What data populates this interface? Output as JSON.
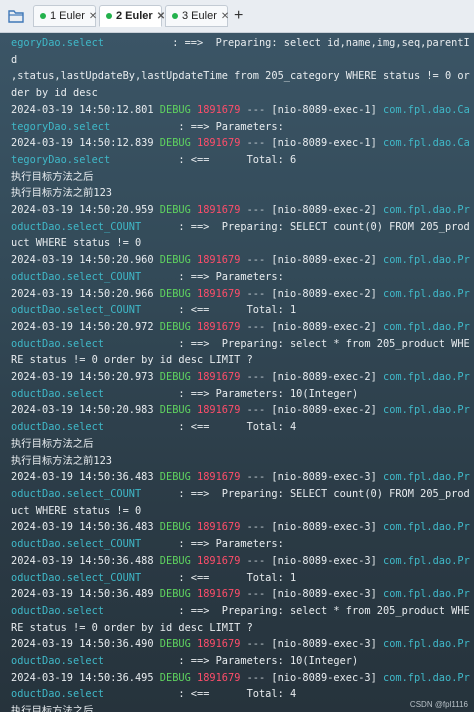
{
  "tabs": [
    {
      "label": "1 Euler",
      "status_color": "#22b14c"
    },
    {
      "label": "2 Euler",
      "status_color": "#22b14c"
    },
    {
      "label": "3 Euler",
      "status_color": "#22b14c"
    }
  ],
  "add_tab_glyph": "+",
  "close_glyph": "✕",
  "colors": {
    "debug": "#5fd35f",
    "pid": "#ff4d6a",
    "logger": "#3fb8c8",
    "text": "#e8ecef"
  },
  "log_lines": [
    {
      "parts": [
        {
          "c": "lg",
          "t": "egoryDao.select"
        },
        {
          "c": "tx",
          "t": "           : ==>  Preparing: select id,name,img,seq,parentId"
        }
      ]
    },
    {
      "parts": [
        {
          "c": "tx",
          "t": ",status,lastUpdateBy,lastUpdateTime from 205_category WHERE status != 0 order by id desc"
        }
      ]
    },
    {
      "parts": [
        {
          "c": "ts",
          "t": "2024-03-19 14:50:12.801 "
        },
        {
          "c": "lvl",
          "t": "DEBUG "
        },
        {
          "c": "pid",
          "t": "1891679"
        },
        {
          "c": "dash",
          "t": " --- "
        },
        {
          "c": "thread",
          "t": "[nio-8089-exec-1] "
        },
        {
          "c": "lg",
          "t": "com.fpl.dao.CategoryDao.select"
        },
        {
          "c": "tx",
          "t": "           : ==> Parameters: "
        }
      ]
    },
    {
      "parts": [
        {
          "c": "ts",
          "t": "2024-03-19 14:50:12.839 "
        },
        {
          "c": "lvl",
          "t": "DEBUG "
        },
        {
          "c": "pid",
          "t": "1891679"
        },
        {
          "c": "dash",
          "t": " --- "
        },
        {
          "c": "thread",
          "t": "[nio-8089-exec-1] "
        },
        {
          "c": "lg",
          "t": "com.fpl.dao.CategoryDao.select"
        },
        {
          "c": "tx",
          "t": "           : <==      Total: 6"
        }
      ]
    },
    {
      "parts": [
        {
          "c": "tx",
          "t": "执行目标方法之后"
        }
      ]
    },
    {
      "parts": [
        {
          "c": "tx",
          "t": "执行目标方法之前123"
        }
      ]
    },
    {
      "parts": [
        {
          "c": "ts",
          "t": "2024-03-19 14:50:20.959 "
        },
        {
          "c": "lvl",
          "t": "DEBUG "
        },
        {
          "c": "pid",
          "t": "1891679"
        },
        {
          "c": "dash",
          "t": " --- "
        },
        {
          "c": "thread",
          "t": "[nio-8089-exec-2] "
        },
        {
          "c": "lg",
          "t": "com.fpl.dao.ProductDao.select_COUNT"
        },
        {
          "c": "tx",
          "t": "      : ==>  Preparing: SELECT count(0) FROM 205_product WHERE status != 0"
        }
      ]
    },
    {
      "parts": [
        {
          "c": "ts",
          "t": "2024-03-19 14:50:20.960 "
        },
        {
          "c": "lvl",
          "t": "DEBUG "
        },
        {
          "c": "pid",
          "t": "1891679"
        },
        {
          "c": "dash",
          "t": " --- "
        },
        {
          "c": "thread",
          "t": "[nio-8089-exec-2] "
        },
        {
          "c": "lg",
          "t": "com.fpl.dao.ProductDao.select_COUNT"
        },
        {
          "c": "tx",
          "t": "      : ==> Parameters: "
        }
      ]
    },
    {
      "parts": [
        {
          "c": "ts",
          "t": "2024-03-19 14:50:20.966 "
        },
        {
          "c": "lvl",
          "t": "DEBUG "
        },
        {
          "c": "pid",
          "t": "1891679"
        },
        {
          "c": "dash",
          "t": " --- "
        },
        {
          "c": "thread",
          "t": "[nio-8089-exec-2] "
        },
        {
          "c": "lg",
          "t": "com.fpl.dao.ProductDao.select_COUNT"
        },
        {
          "c": "tx",
          "t": "      : <==      Total: 1"
        }
      ]
    },
    {
      "parts": [
        {
          "c": "ts",
          "t": "2024-03-19 14:50:20.972 "
        },
        {
          "c": "lvl",
          "t": "DEBUG "
        },
        {
          "c": "pid",
          "t": "1891679"
        },
        {
          "c": "dash",
          "t": " --- "
        },
        {
          "c": "thread",
          "t": "[nio-8089-exec-2] "
        },
        {
          "c": "lg",
          "t": "com.fpl.dao.ProductDao.select"
        },
        {
          "c": "tx",
          "t": "            : ==>  Preparing: select * from 205_product WHERE status != 0 order by id desc LIMIT ? "
        }
      ]
    },
    {
      "parts": [
        {
          "c": "ts",
          "t": "2024-03-19 14:50:20.973 "
        },
        {
          "c": "lvl",
          "t": "DEBUG "
        },
        {
          "c": "pid",
          "t": "1891679"
        },
        {
          "c": "dash",
          "t": " --- "
        },
        {
          "c": "thread",
          "t": "[nio-8089-exec-2] "
        },
        {
          "c": "lg",
          "t": "com.fpl.dao.ProductDao.select"
        },
        {
          "c": "tx",
          "t": "            : ==> Parameters: 10(Integer)"
        }
      ]
    },
    {
      "parts": [
        {
          "c": "ts",
          "t": "2024-03-19 14:50:20.983 "
        },
        {
          "c": "lvl",
          "t": "DEBUG "
        },
        {
          "c": "pid",
          "t": "1891679"
        },
        {
          "c": "dash",
          "t": " --- "
        },
        {
          "c": "thread",
          "t": "[nio-8089-exec-2] "
        },
        {
          "c": "lg",
          "t": "com.fpl.dao.ProductDao.select"
        },
        {
          "c": "tx",
          "t": "            : <==      Total: 4"
        }
      ]
    },
    {
      "parts": [
        {
          "c": "tx",
          "t": "执行目标方法之后"
        }
      ]
    },
    {
      "parts": [
        {
          "c": "tx",
          "t": "执行目标方法之前123"
        }
      ]
    },
    {
      "parts": [
        {
          "c": "ts",
          "t": "2024-03-19 14:50:36.483 "
        },
        {
          "c": "lvl",
          "t": "DEBUG "
        },
        {
          "c": "pid",
          "t": "1891679"
        },
        {
          "c": "dash",
          "t": " --- "
        },
        {
          "c": "thread",
          "t": "[nio-8089-exec-3] "
        },
        {
          "c": "lg",
          "t": "com.fpl.dao.ProductDao.select_COUNT"
        },
        {
          "c": "tx",
          "t": "      : ==>  Preparing: SELECT count(0) FROM 205_product WHERE status != 0"
        }
      ]
    },
    {
      "parts": [
        {
          "c": "ts",
          "t": "2024-03-19 14:50:36.483 "
        },
        {
          "c": "lvl",
          "t": "DEBUG "
        },
        {
          "c": "pid",
          "t": "1891679"
        },
        {
          "c": "dash",
          "t": " --- "
        },
        {
          "c": "thread",
          "t": "[nio-8089-exec-3] "
        },
        {
          "c": "lg",
          "t": "com.fpl.dao.ProductDao.select_COUNT"
        },
        {
          "c": "tx",
          "t": "      : ==> Parameters: "
        }
      ]
    },
    {
      "parts": [
        {
          "c": "ts",
          "t": "2024-03-19 14:50:36.488 "
        },
        {
          "c": "lvl",
          "t": "DEBUG "
        },
        {
          "c": "pid",
          "t": "1891679"
        },
        {
          "c": "dash",
          "t": " --- "
        },
        {
          "c": "thread",
          "t": "[nio-8089-exec-3] "
        },
        {
          "c": "lg",
          "t": "com.fpl.dao.ProductDao.select_COUNT"
        },
        {
          "c": "tx",
          "t": "      : <==      Total: 1"
        }
      ]
    },
    {
      "parts": [
        {
          "c": "ts",
          "t": "2024-03-19 14:50:36.489 "
        },
        {
          "c": "lvl",
          "t": "DEBUG "
        },
        {
          "c": "pid",
          "t": "1891679"
        },
        {
          "c": "dash",
          "t": " --- "
        },
        {
          "c": "thread",
          "t": "[nio-8089-exec-3] "
        },
        {
          "c": "lg",
          "t": "com.fpl.dao.ProductDao.select"
        },
        {
          "c": "tx",
          "t": "            : ==>  Preparing: select * from 205_product WHERE status != 0 order by id desc LIMIT ? "
        }
      ]
    },
    {
      "parts": [
        {
          "c": "ts",
          "t": "2024-03-19 14:50:36.490 "
        },
        {
          "c": "lvl",
          "t": "DEBUG "
        },
        {
          "c": "pid",
          "t": "1891679"
        },
        {
          "c": "dash",
          "t": " --- "
        },
        {
          "c": "thread",
          "t": "[nio-8089-exec-3] "
        },
        {
          "c": "lg",
          "t": "com.fpl.dao.ProductDao.select"
        },
        {
          "c": "tx",
          "t": "            : ==> Parameters: 10(Integer)"
        }
      ]
    },
    {
      "parts": [
        {
          "c": "ts",
          "t": "2024-03-19 14:50:36.495 "
        },
        {
          "c": "lvl",
          "t": "DEBUG "
        },
        {
          "c": "pid",
          "t": "1891679"
        },
        {
          "c": "dash",
          "t": " --- "
        },
        {
          "c": "thread",
          "t": "[nio-8089-exec-3] "
        },
        {
          "c": "lg",
          "t": "com.fpl.dao.ProductDao.select"
        },
        {
          "c": "tx",
          "t": "            : <==      Total: 4"
        }
      ]
    },
    {
      "parts": [
        {
          "c": "tx",
          "t": "执行目标方法之后"
        }
      ]
    }
  ],
  "watermark": "CSDN @fpl1116"
}
